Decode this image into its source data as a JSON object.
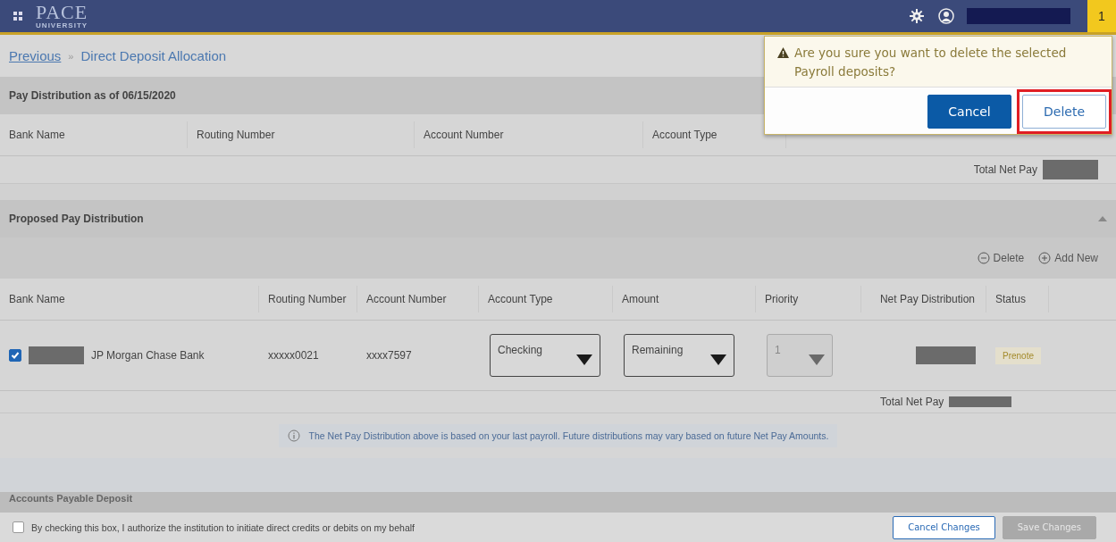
{
  "topbar": {
    "logo": "PACE",
    "logo_sub": "UNIVERSITY",
    "badge": "1"
  },
  "breadcrumb": {
    "previous": "Previous",
    "separator": "»",
    "current": "Direct Deposit Allocation"
  },
  "current_distribution": {
    "title": "Pay Distribution as of 06/15/2020",
    "columns": [
      "Bank Name",
      "Routing Number",
      "Account Number",
      "Account Type"
    ],
    "total_label": "Total Net Pay"
  },
  "proposed_distribution": {
    "title": "Proposed Pay Distribution",
    "expanded": true,
    "actions": [
      {
        "kind": "delete",
        "label": "Delete"
      },
      {
        "kind": "add",
        "label": "Add New"
      }
    ],
    "columns": [
      "Bank Name",
      "Routing Number",
      "Account Number",
      "Account Type",
      "Amount",
      "Priority",
      "Net Pay Distribution",
      "Status"
    ],
    "rows": [
      {
        "selected": true,
        "bank_name": "JP Morgan Chase Bank",
        "routing_number": "xxxxx0021",
        "account_number": "xxxx7597",
        "account_type": {
          "value": "Checking",
          "disabled": false
        },
        "amount": {
          "value": "Remaining",
          "disabled": false
        },
        "priority": {
          "value": "1",
          "disabled": true
        },
        "status": "Prenote"
      }
    ],
    "total_label": "Total Net Pay",
    "info": "The Net Pay Distribution above is based on your last payroll. Future distributions may vary based on future Net Pay Amounts."
  },
  "accounts_payable": {
    "title": "Accounts Payable Deposit"
  },
  "footer": {
    "authorize": {
      "label": "By checking this box, I authorize the institution to initiate direct credits or debits on my behalf",
      "checked": false
    },
    "buttons": [
      {
        "label": "Cancel Changes",
        "disabled": false
      },
      {
        "label": "Save Changes",
        "disabled": true
      }
    ]
  },
  "dialog": {
    "message": "Are you sure you want to delete the selected Payroll deposits?",
    "buttons": [
      {
        "kind": "primary",
        "label": "Cancel",
        "highlighted": false
      },
      {
        "kind": "secondary",
        "label": "Delete",
        "highlighted": true
      }
    ]
  }
}
